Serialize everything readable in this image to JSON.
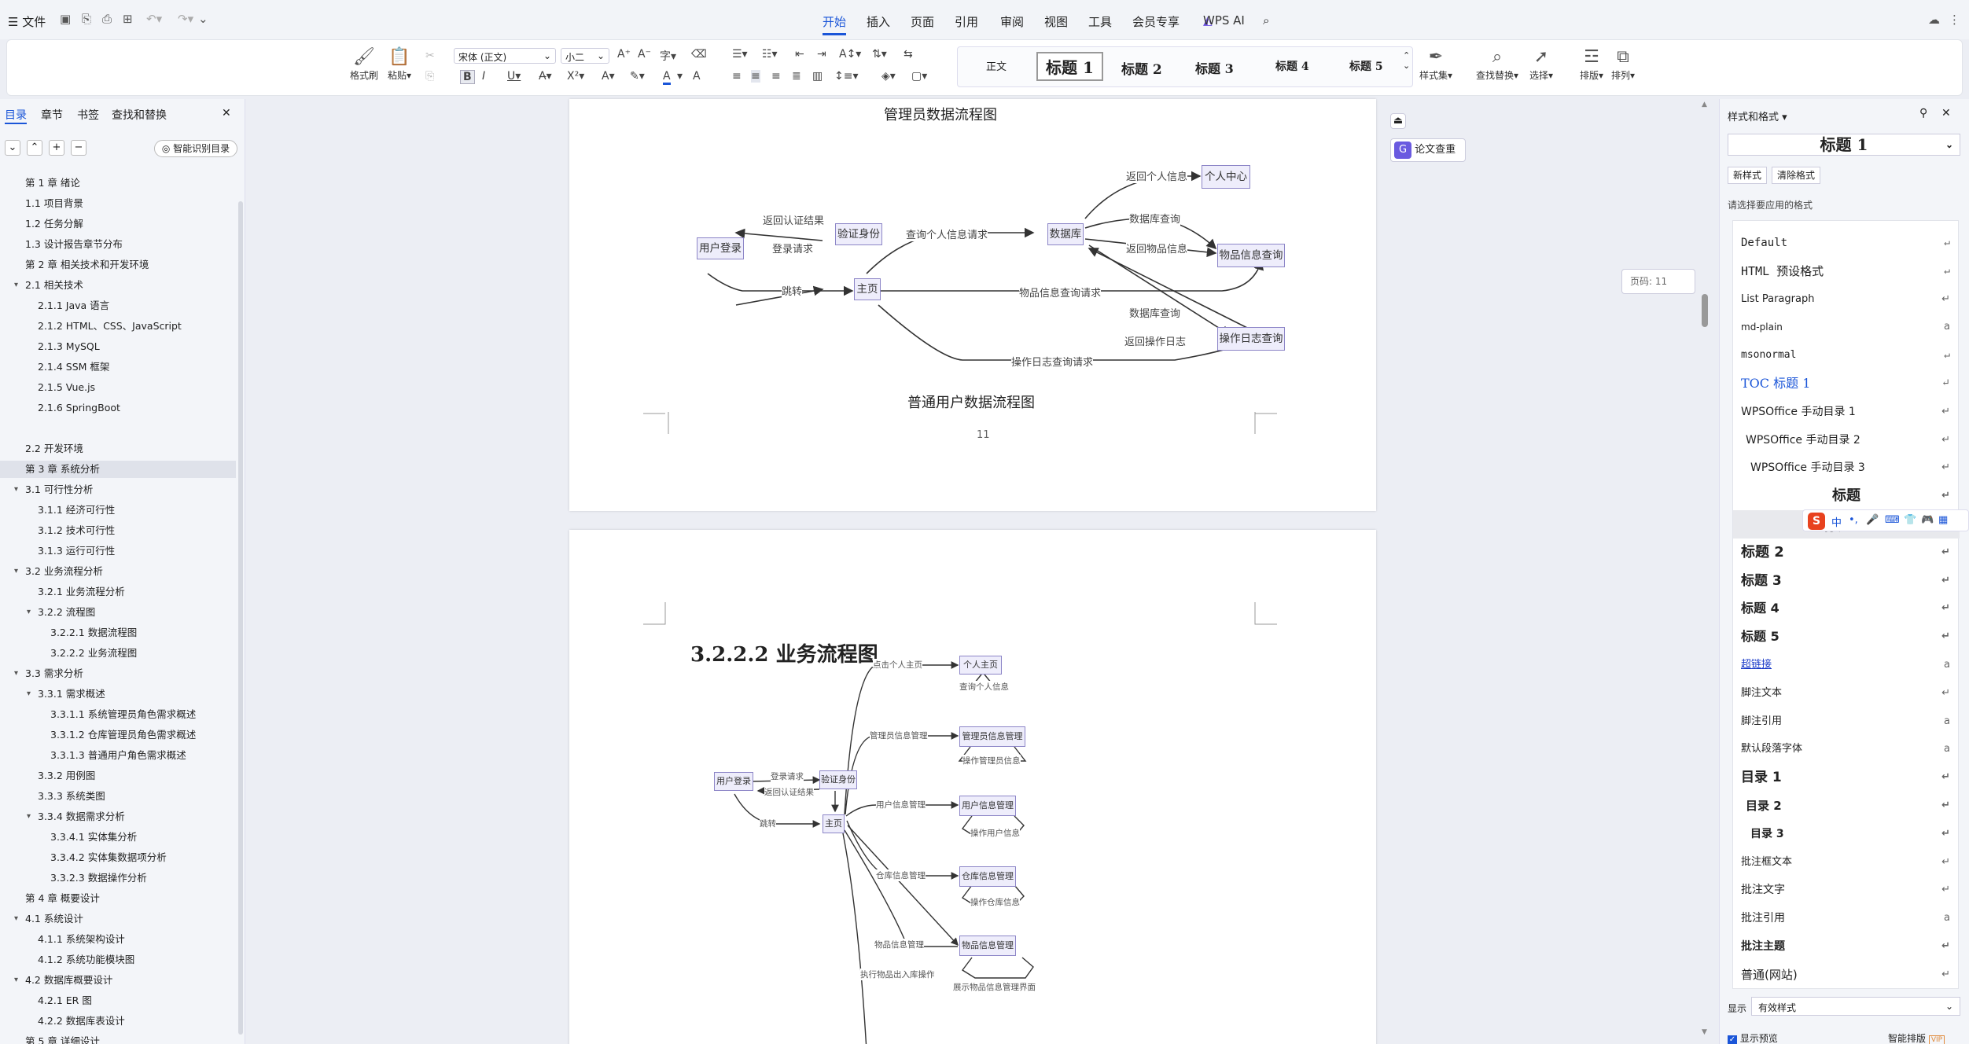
{
  "menubar": {
    "file_label": "文件",
    "tabs": [
      "开始",
      "插入",
      "页面",
      "引用",
      "审阅",
      "视图",
      "工具",
      "会员专享"
    ],
    "wps_ai": "WPS AI"
  },
  "ribbon": {
    "format_painter": "格式刷",
    "paste": "粘贴",
    "font_name": "宋体 (正文)",
    "font_size": "小二",
    "styles": [
      "正文",
      "标题 1",
      "标题 2",
      "标题 3",
      "标题 4",
      "标题 5"
    ],
    "style_set": "样式集",
    "find_replace": "查找替换",
    "select": "选择",
    "layout": "排版",
    "arrange": "排列"
  },
  "left_panel": {
    "tabs": [
      "目录",
      "章节",
      "书签",
      "查找和替换"
    ],
    "smart_toc": "智能识别目录",
    "toc": [
      {
        "label": "第 1 章  绪论",
        "level": 0
      },
      {
        "label": "1.1  项目背景",
        "level": 0
      },
      {
        "label": "1.2  任务分解",
        "level": 0
      },
      {
        "label": "1.3  设计报告章节分布",
        "level": 0
      },
      {
        "label": "第 2 章  相关技术和开发环境",
        "level": 0
      },
      {
        "label": "2.1  相关技术",
        "level": 0,
        "arrow": true
      },
      {
        "label": "2.1.1 Java 语言",
        "level": 1
      },
      {
        "label": "2.1.2 HTML、CSS、JavaScript",
        "level": 1
      },
      {
        "label": "2.1.3 MySQL",
        "level": 1
      },
      {
        "label": "2.1.4 SSM 框架",
        "level": 1
      },
      {
        "label": "2.1.5 Vue.js",
        "level": 1
      },
      {
        "label": "2.1.6 SpringBoot",
        "level": 1
      },
      {
        "label": "",
        "level": 0
      },
      {
        "label": "2.2  开发环境",
        "level": 0
      },
      {
        "label": "第 3 章  系统分析",
        "level": 0,
        "selected": true
      },
      {
        "label": "3.1  可行性分析",
        "level": 0,
        "arrow": true
      },
      {
        "label": "3.1.1  经济可行性",
        "level": 1
      },
      {
        "label": "3.1.2  技术可行性",
        "level": 1
      },
      {
        "label": "3.1.3  运行可行性",
        "level": 1
      },
      {
        "label": "3.2  业务流程分析",
        "level": 0,
        "arrow": true
      },
      {
        "label": "3.2.1  业务流程分析",
        "level": 1
      },
      {
        "label": "3.2.2  流程图",
        "level": 1,
        "arrow": true
      },
      {
        "label": "3.2.2.1  数据流程图",
        "level": 2
      },
      {
        "label": "3.2.2.2  业务流程图",
        "level": 2
      },
      {
        "label": "3.3  需求分析",
        "level": 0,
        "arrow": true
      },
      {
        "label": "3.3.1  需求概述",
        "level": 1,
        "arrow": true
      },
      {
        "label": "3.3.1.1  系统管理员角色需求概述",
        "level": 2
      },
      {
        "label": "3.3.1.2  仓库管理员角色需求概述",
        "level": 2
      },
      {
        "label": "3.3.1.3  普通用户角色需求概述",
        "level": 2
      },
      {
        "label": "3.3.2  用例图",
        "level": 1
      },
      {
        "label": "3.3.3  系统类图",
        "level": 1
      },
      {
        "label": "3.3.4  数据需求分析",
        "level": 1,
        "arrow": true
      },
      {
        "label": "3.3.4.1  实体集分析",
        "level": 2
      },
      {
        "label": "3.3.4.2  实体集数据项分析",
        "level": 2
      },
      {
        "label": "3.3.2.3  数据操作分析",
        "level": 2
      },
      {
        "label": "第 4 章  概要设计",
        "level": 0
      },
      {
        "label": "4.1  系统设计",
        "level": 0,
        "arrow": true
      },
      {
        "label": "4.1.1  系统架构设计",
        "level": 1
      },
      {
        "label": "4.1.2  系统功能模块图",
        "level": 1
      },
      {
        "label": "4.2  数据库概要设计",
        "level": 0,
        "arrow": true
      },
      {
        "label": "4.2.1  ER 图",
        "level": 1
      },
      {
        "label": "4.2.2  数据库表设计",
        "level": 1
      },
      {
        "label": "第 5 章  详细设计",
        "level": 0
      }
    ]
  },
  "document": {
    "page1": {
      "caption_top": "管理员数据流程图",
      "caption_bottom": "普通用户数据流程图",
      "page_number": "11",
      "nodes": {
        "login": "用户登录",
        "verify": "验证身份",
        "home": "主页",
        "db": "数据库",
        "personal": "个人中心",
        "item": "物品信息查询",
        "oplog": "操作日志查询"
      },
      "edges": {
        "return_auth": "返回认证结果",
        "login_req": "登录请求",
        "jump": "跳转",
        "query_personal": "查询个人信息请求",
        "return_personal": "返回个人信息",
        "db_query1": "数据库查询",
        "return_item": "返回物品信息",
        "item_query_req": "物品信息查询请求",
        "db_query2": "数据库查询",
        "return_oplog": "返回操作日志",
        "oplog_req": "操作日志查询请求"
      }
    },
    "page2": {
      "heading": "3.2.2.2  业务流程图",
      "nodes": {
        "login": "用户登录",
        "verify": "验证身份",
        "home": "主页",
        "personal": "个人主页",
        "admin_mgmt": "管理员信息管理",
        "user_mgmt": "用户信息管理",
        "warehouse_mgmt": "仓库信息管理",
        "item_mgmt": "物品信息管理"
      },
      "edges": {
        "login_req": "登录请求",
        "return_auth": "返回认证结果",
        "jump": "跳转",
        "click_personal": "点击个人主页",
        "query_personal": "查询个人信息",
        "admin_mgmt": "管理员信息管理",
        "op_admin": "操作管理员信息",
        "user_mgmt": "用户信息管理",
        "op_user": "操作用户信息",
        "warehouse_mgmt": "仓库信息管理",
        "op_warehouse": "操作仓库信息",
        "item_mgmt": "物品信息管理",
        "exec_io": "执行物品出入库操作",
        "show_item": "展示物品信息管理界面"
      }
    }
  },
  "float": {
    "plagiarism": "论文查重",
    "page_indicator": "页码: 11"
  },
  "right_panel": {
    "title": "样式和格式",
    "current_style": "标题  1",
    "new_style": "新样式",
    "clear_format": "清除格式",
    "hint": "请选择要应用的格式",
    "styles": [
      "Default",
      "HTML 预设格式",
      "List Paragraph",
      "md-plain",
      "msonormal",
      "TOC 标题 1",
      "WPSOffice 手动目录 1",
      "WPSOffice 手动目录 2",
      "WPSOffice 手动目录 3",
      "标题",
      "标题 1",
      "标题 2",
      "标题 3",
      "标题 4",
      "标题 5",
      "超链接",
      "脚注文本",
      "脚注引用",
      "默认段落字体",
      "目录 1",
      "目录 2",
      "目录 3",
      "批注框文本",
      "批注文字",
      "批注引用",
      "批注主题",
      "普通(网站)"
    ],
    "show_label": "显示",
    "show_value": "有效样式",
    "preview_label": "显示预览",
    "smart_layout": "智能排版"
  },
  "ime": {
    "lang": "中"
  },
  "colors": {
    "accent": "#1a55d8",
    "node_border": "#8c85c7",
    "node_fill": "#eeedfb"
  }
}
